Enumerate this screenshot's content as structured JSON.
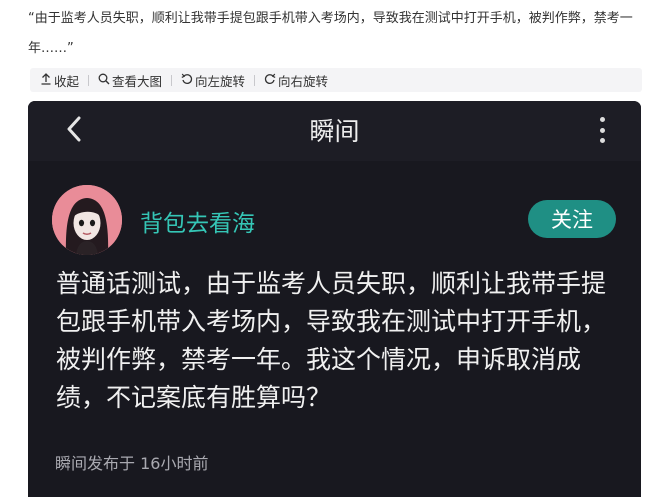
{
  "article": {
    "quote": "“由于监考人员失职，顺利让我带手提包跟手机带入考场内，导致我在测试中打开手机，被判作弊，禁考一年……”"
  },
  "toolbar": {
    "collapse_label": "收起",
    "view_large_label": "查看大图",
    "rotate_left_label": "向左旋转",
    "rotate_right_label": "向右旋转"
  },
  "screenshot": {
    "header_title": "瞬间",
    "username": "背包去看海",
    "follow_label": "关注",
    "post_text": "普通话测试，由于监考人员失职，顺利让我带手提包跟手机带入考场内，导致我在测试中打开手机，被判作弊，禁考一年。我这个情况，申诉取消成绩，不记案底有胜算吗？",
    "meta": "瞬间发布于 16小时前",
    "icons": {
      "back": "chevron-left-icon",
      "more": "more-vertical-icon"
    },
    "colors": {
      "background": "#18181f",
      "username": "#35c6b6",
      "follow_button": "#1f8f84"
    }
  }
}
